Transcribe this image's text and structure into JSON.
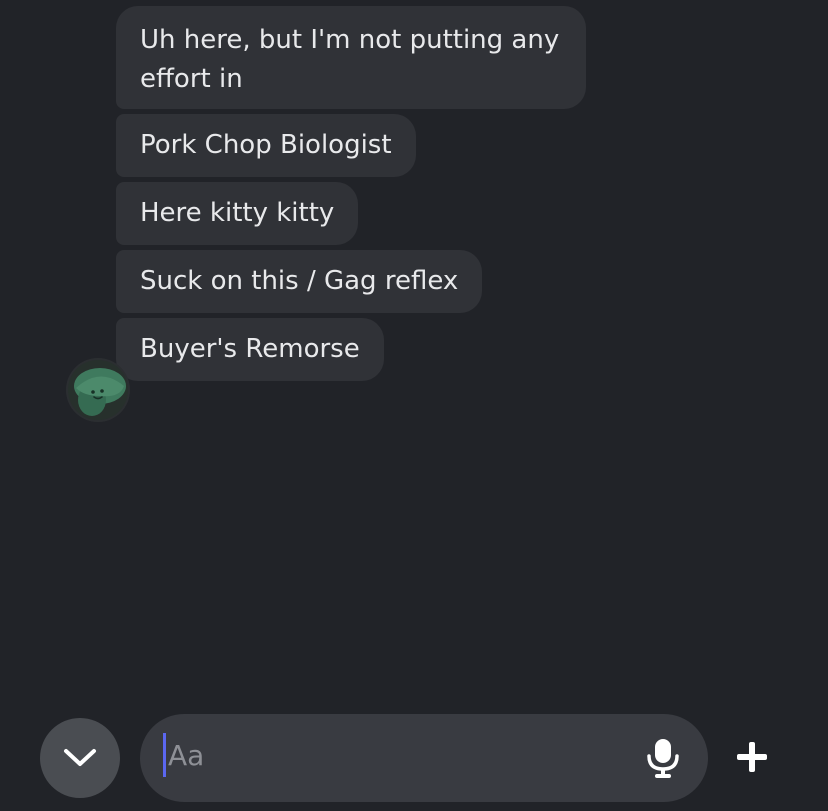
{
  "messages": [
    {
      "text": "Uh here, but I'm not putting any effort in"
    },
    {
      "text": "Pork Chop Biologist"
    },
    {
      "text": "Here kitty kitty"
    },
    {
      "text": "Suck on this / Gag reflex"
    },
    {
      "text": "Buyer's Remorse"
    }
  ],
  "composer": {
    "placeholder": "Aa",
    "mic_icon": "microphone-icon",
    "plus_icon": "plus-icon",
    "scroll_down_icon": "chevron-down-icon"
  },
  "colors": {
    "background": "#212328",
    "bubble": "#303237",
    "input": "#393b41",
    "caret": "#5b67f0"
  }
}
